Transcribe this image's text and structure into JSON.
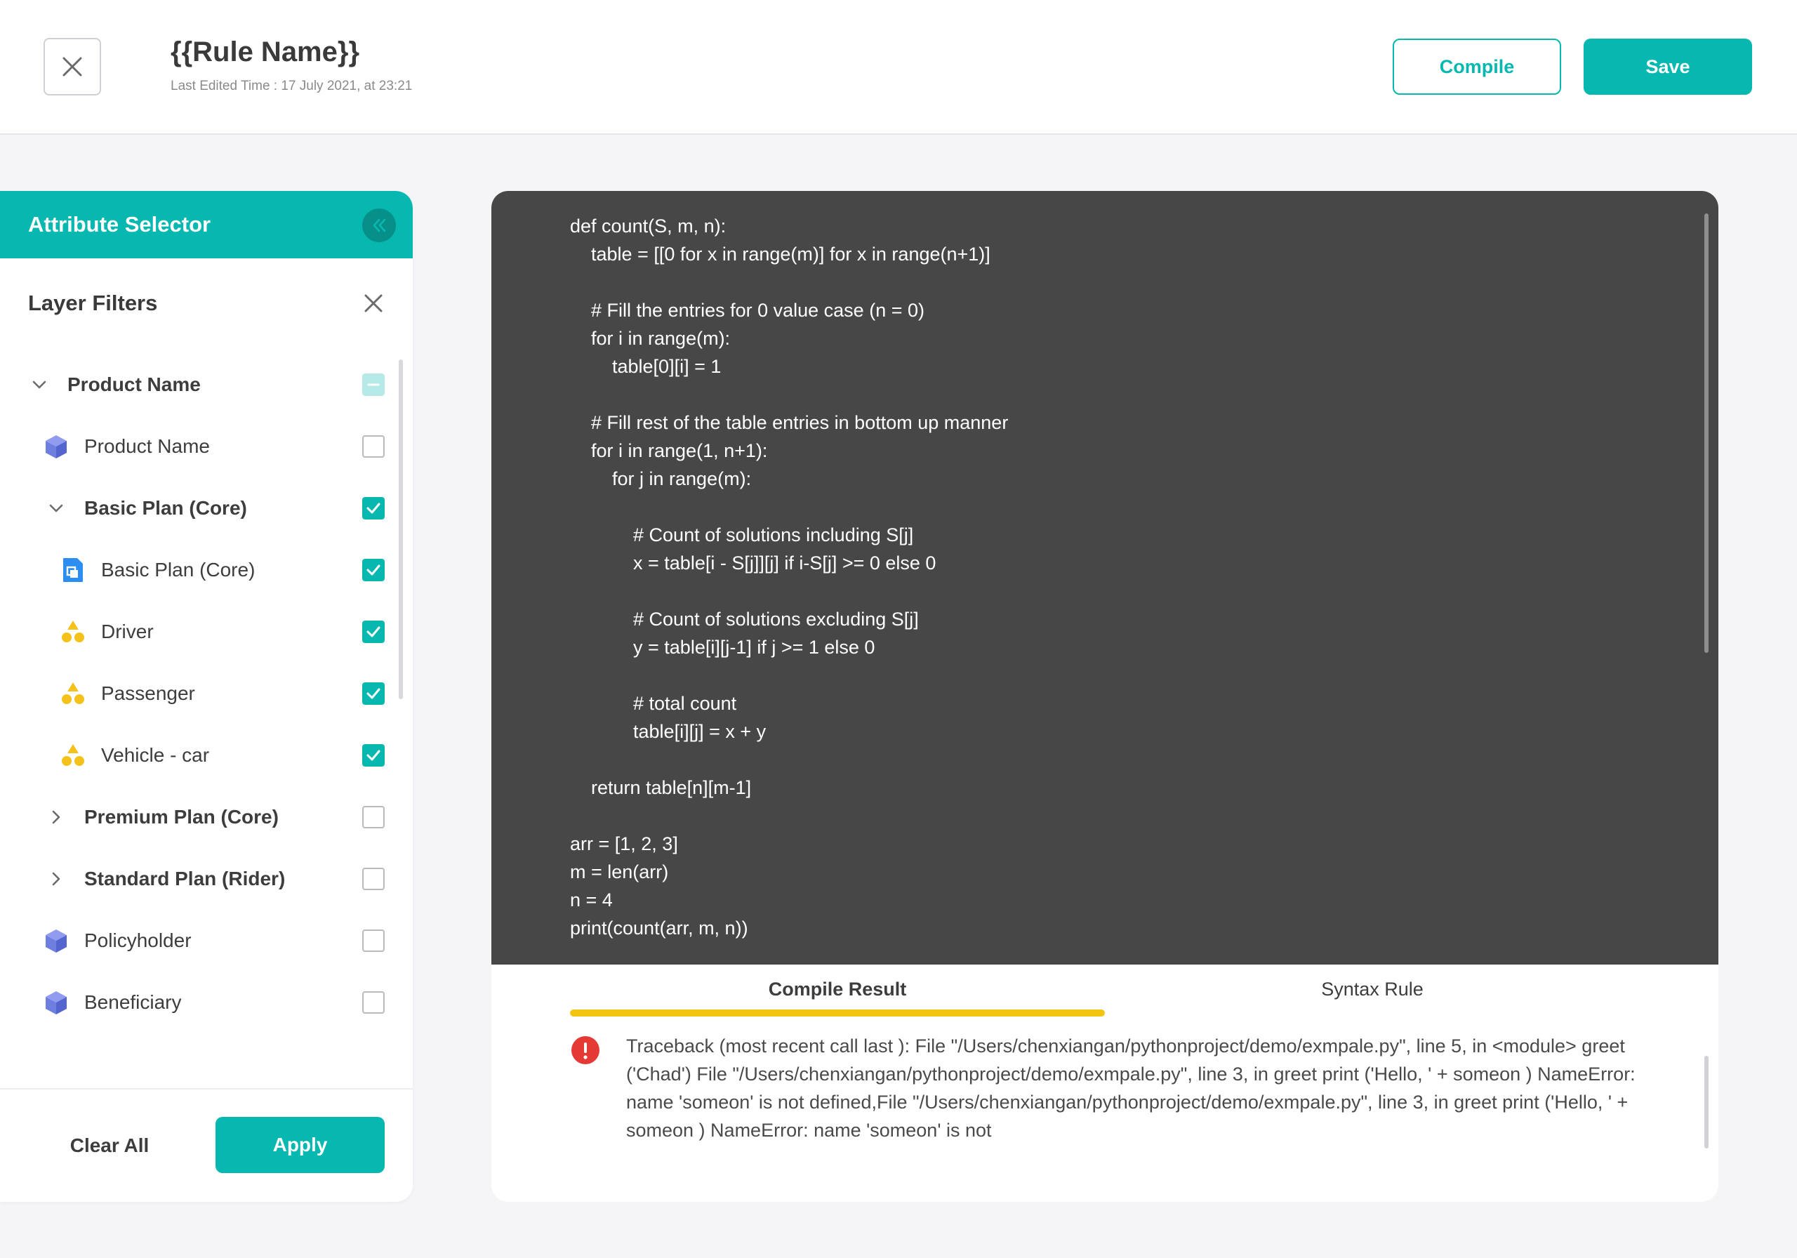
{
  "header": {
    "rule_name": "{{Rule Name}}",
    "last_edited": "Last Edited Time : 17 July 2021, at 23:21",
    "compile_label": "Compile",
    "save_label": "Save",
    "close_icon": "close-icon"
  },
  "sidebar": {
    "title": "Attribute Selector",
    "collapse_icon": "double-chevron-left-icon",
    "layer_filters_title": "Layer Filters",
    "items": [
      {
        "label": "Product Name",
        "icon": "chevron-down-icon",
        "type": "group",
        "state": "partial"
      },
      {
        "label": "Product Name",
        "icon": "cube-icon",
        "type": "leaf",
        "state": "unchecked"
      },
      {
        "label": "Basic Plan (Core)",
        "icon": "chevron-down-icon",
        "type": "group",
        "state": "checked"
      },
      {
        "label": "Basic Plan (Core)",
        "icon": "document-copy-icon",
        "type": "leaf",
        "state": "checked"
      },
      {
        "label": "Driver",
        "icon": "shapes-icon",
        "type": "leaf",
        "state": "checked"
      },
      {
        "label": "Passenger",
        "icon": "shapes-icon",
        "type": "leaf",
        "state": "checked"
      },
      {
        "label": "Vehicle - car",
        "icon": "shapes-icon",
        "type": "leaf",
        "state": "checked"
      },
      {
        "label": "Premium Plan (Core)",
        "icon": "chevron-right-icon",
        "type": "group",
        "state": "unchecked"
      },
      {
        "label": "Standard Plan (Rider)",
        "icon": "chevron-right-icon",
        "type": "group",
        "state": "unchecked"
      },
      {
        "label": "Policyholder",
        "icon": "cube-icon",
        "type": "leaf",
        "state": "unchecked"
      },
      {
        "label": "Beneficiary",
        "icon": "cube-icon",
        "type": "leaf",
        "state": "unchecked"
      }
    ],
    "clear_all_label": "Clear All",
    "apply_label": "Apply"
  },
  "editor": {
    "code": "def count(S, m, n):\n    table = [[0 for x in range(m)] for x in range(n+1)]\n\n    # Fill the entries for 0 value case (n = 0)\n    for i in range(m):\n        table[0][i] = 1\n\n    # Fill rest of the table entries in bottom up manner\n    for i in range(1, n+1):\n        for j in range(m):\n\n            # Count of solutions including S[j]\n            x = table[i - S[j]][j] if i-S[j] >= 0 else 0\n\n            # Count of solutions excluding S[j]\n            y = table[i][j-1] if j >= 1 else 0\n\n            # total count\n            table[i][j] = x + y\n\n    return table[n][m-1]\n\narr = [1, 2, 3]\nm = len(arr)\nn = 4\nprint(count(arr, m, n))",
    "tabs": [
      {
        "label": "Compile Result",
        "active": true
      },
      {
        "label": "Syntax Rule",
        "active": false
      }
    ],
    "result_icon": "error-icon",
    "result_text": "Traceback (most recent call last ): File \"/Users/chenxiangan/pythonproject/demo/exmpale.py\", line 5, in <module> greet ('Chad') File \"/Users/chenxiangan/pythonproject/demo/exmpale.py\", line 3, in greet print ('Hello, ' + someon ) NameError: name 'someon' is not defined,File \"/Users/chenxiangan/pythonproject/demo/exmpale.py\", line 3, in greet print ('Hello, ' + someon ) NameError: name 'someon' is not"
  },
  "colors": {
    "accent": "#07b8b0",
    "editor_bg": "#474747",
    "tab_underline": "#f2c511",
    "error": "#e53935",
    "cube_icon": "#6f7fe0",
    "shapes_icon": "#f5c21b",
    "document_icon": "#2b8ef0"
  }
}
